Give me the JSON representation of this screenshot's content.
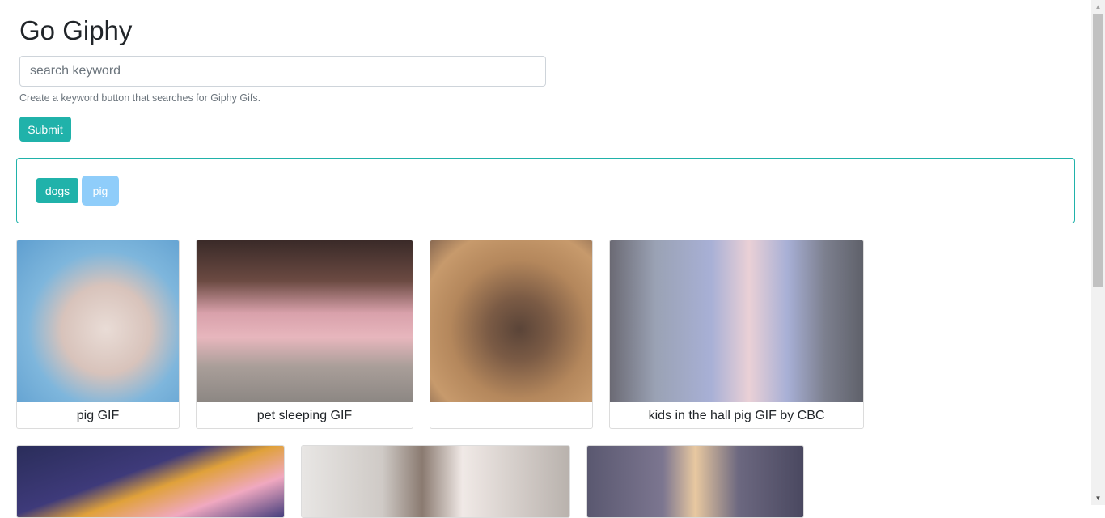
{
  "app": {
    "title": "Go Giphy"
  },
  "search": {
    "placeholder": "search keyword",
    "value": "",
    "help_text": "Create a keyword button that searches for Giphy Gifs.",
    "submit_label": "Submit"
  },
  "keywords": [
    {
      "label": "dogs",
      "state": "default"
    },
    {
      "label": "pig",
      "state": "hover"
    }
  ],
  "gifs": [
    {
      "caption": "pig GIF"
    },
    {
      "caption": "pet sleeping GIF"
    },
    {
      "caption": ""
    },
    {
      "caption": "kids in the hall pig GIF by CBC"
    },
    {
      "caption": ""
    },
    {
      "caption": ""
    },
    {
      "caption": ""
    }
  ],
  "colors": {
    "accent": "#20b2aa",
    "keyword_hover": "#8fcdfa",
    "help_text": "#6c757d",
    "border": "#dcdcdc"
  },
  "icons": {
    "scroll_up": "triangle-up-icon",
    "scroll_down": "triangle-down-icon"
  }
}
